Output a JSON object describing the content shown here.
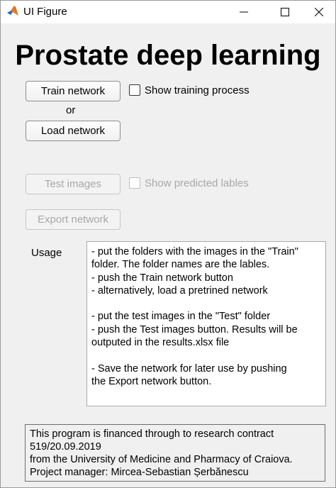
{
  "window": {
    "title": "UI Figure",
    "app_icon": "matlab-icon"
  },
  "heading": "Prostate deep learning",
  "buttons": {
    "train": "Train network",
    "load": "Load network",
    "test": "Test images",
    "export": "Export network"
  },
  "or_label": "or",
  "checkboxes": {
    "show_training": {
      "label": "Show training process",
      "checked": false,
      "enabled": true
    },
    "show_predicted": {
      "label": "Show predicted lables",
      "checked": false,
      "enabled": false
    }
  },
  "usage": {
    "label": "Usage",
    "lines": [
      "- put the folders with the images in the \"Train\"",
      "folder. The folder names are the lables.",
      "- push the Train network button",
      "- alternatively, load a pretrined network",
      "",
      "- put the test images in the \"Test\" folder",
      "- push the Test images button. Results will be",
      "outputed in the results.xlsx file",
      "",
      "- Save the network for later use by pushing",
      "the Export network button."
    ]
  },
  "footer": {
    "lines": [
      "This program is financed through to research contract",
      "519/20.09.2019",
      "from the University of Medicine and Pharmacy of Craiova.",
      "Project manager: Mircea-Sebastian Șerbănescu"
    ]
  }
}
